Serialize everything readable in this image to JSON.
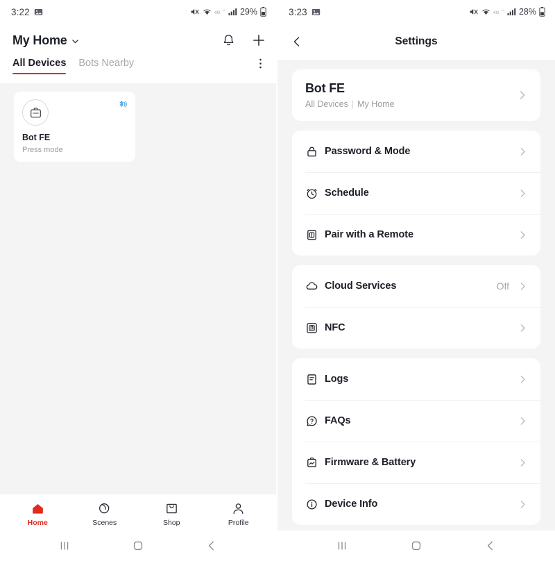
{
  "colors": {
    "accent_red": "#e02b20",
    "bluetooth_blue": "#4aa3dd",
    "text_primary": "#1c1f27",
    "text_muted": "#9a9b9f",
    "page_bg": "#f4f4f4",
    "card_bg": "#ffffff"
  },
  "home_screen": {
    "status_bar": {
      "time": "3:22",
      "battery_percent": "29%",
      "icons": [
        "image-icon",
        "mute-icon",
        "wifi-icon",
        "4g-icon",
        "signal-bars-icon",
        "battery-icon"
      ]
    },
    "app_bar": {
      "title": "My Home",
      "dropdown_icon": "chevron-down-icon",
      "notifications_icon": "bell-icon",
      "add_icon": "plus-icon"
    },
    "tabs": [
      {
        "label": "All Devices",
        "active": true
      },
      {
        "label": "Bots Nearby",
        "active": false
      }
    ],
    "overflow_icon": "kebab-menu-icon",
    "devices": [
      {
        "name": "Bot FE",
        "status": "Press mode",
        "device_icon": "bot-icon",
        "connection_icon": "bluetooth-icon"
      }
    ],
    "bottom_nav": [
      {
        "label": "Home",
        "icon": "home-icon",
        "active": true
      },
      {
        "label": "Scenes",
        "icon": "scenes-icon",
        "active": false
      },
      {
        "label": "Shop",
        "icon": "shop-icon",
        "active": false
      },
      {
        "label": "Profile",
        "icon": "profile-icon",
        "active": false
      }
    ],
    "system_nav": [
      "recents-icon",
      "home-button-icon",
      "back-icon"
    ]
  },
  "settings_screen": {
    "status_bar": {
      "time": "3:23",
      "battery_percent": "28%",
      "icons": [
        "image-icon",
        "mute-icon",
        "wifi-icon",
        "4g-icon",
        "signal-bars-icon",
        "battery-icon"
      ]
    },
    "header": {
      "back_icon": "back-chevron-icon",
      "title": "Settings"
    },
    "device_card": {
      "name": "Bot FE",
      "room": "All Devices",
      "separator": "|",
      "home": "My Home",
      "chevron_icon": "chevron-right-icon"
    },
    "groups": [
      {
        "rows": [
          {
            "label": "Password & Mode",
            "icon": "lock-icon",
            "value": ""
          },
          {
            "label": "Schedule",
            "icon": "alarm-icon",
            "value": ""
          },
          {
            "label": "Pair with a Remote",
            "icon": "remote-icon",
            "value": ""
          }
        ]
      },
      {
        "rows": [
          {
            "label": "Cloud Services",
            "icon": "cloud-icon",
            "value": "Off"
          },
          {
            "label": "NFC",
            "icon": "nfc-icon",
            "value": ""
          }
        ]
      },
      {
        "rows": [
          {
            "label": "Logs",
            "icon": "logs-icon",
            "value": ""
          },
          {
            "label": "FAQs",
            "icon": "faq-icon",
            "value": ""
          },
          {
            "label": "Firmware & Battery",
            "icon": "firmware-icon",
            "value": ""
          },
          {
            "label": "Device Info",
            "icon": "info-icon",
            "value": ""
          }
        ]
      }
    ],
    "system_nav": [
      "recents-icon",
      "home-button-icon",
      "back-icon"
    ]
  }
}
